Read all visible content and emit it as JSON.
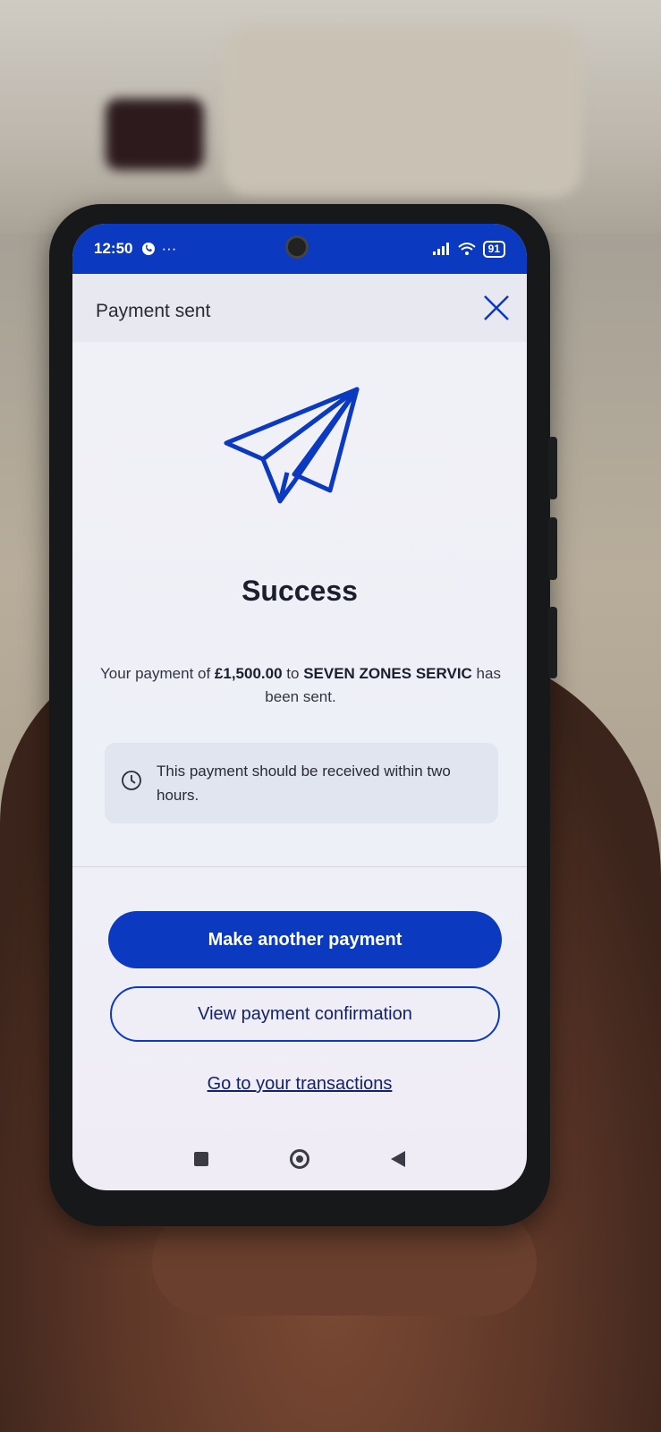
{
  "status_bar": {
    "time": "12:50",
    "dots": "···",
    "battery": "91"
  },
  "header": {
    "title": "Payment sent"
  },
  "main": {
    "title": "Success",
    "message_prefix": "Your payment of ",
    "amount": "£1,500.00",
    "message_to": " to ",
    "payee": "SEVEN ZONES SERVIC",
    "message_suffix": " has been sent.",
    "info_text": "This payment should be received within two hours."
  },
  "actions": {
    "primary_label": "Make another payment",
    "secondary_label": "View payment confirmation",
    "link_label": "Go to your transactions"
  },
  "colors": {
    "brand": "#0b3ac0",
    "text": "#1c1e2e"
  },
  "icons": [
    "close-icon",
    "paper-plane-icon",
    "clock-icon",
    "nav-recents-icon",
    "nav-home-icon",
    "nav-back-icon"
  ]
}
